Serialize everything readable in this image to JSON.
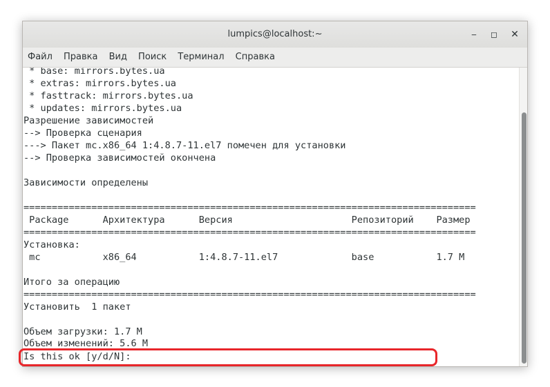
{
  "window": {
    "title": "lumpics@localhost:~",
    "controls": {
      "minimize": "‒",
      "maximize": "◻",
      "close": "✕"
    }
  },
  "menu": [
    "Файл",
    "Правка",
    "Вид",
    "Поиск",
    "Терминал",
    "Справка"
  ],
  "terminal_lines": [
    " * base: mirrors.bytes.ua",
    " * extras: mirrors.bytes.ua",
    " * fasttrack: mirrors.bytes.ua",
    " * updates: mirrors.bytes.ua",
    "Разрешение зависимостей",
    "--> Проверка сценария",
    "---> Пакет mc.x86_64 1:4.8.7-11.el7 помечен для установки",
    "--> Проверка зависимостей окончена",
    "",
    "Зависимости определены",
    "",
    "================================================================================",
    " Package      Архитектура      Версия                     Репозиторий    Размер",
    "================================================================================",
    "Установка:",
    " mc           x86_64           1:4.8.7-11.el7             base           1.7 M",
    "",
    "Итого за операцию",
    "================================================================================",
    "Установить  1 пакет",
    "",
    "Объем загрузки: 1.7 M",
    "Объем изменений: 5.6 M",
    "Is this ok [y/d/N]: "
  ],
  "colors": {
    "text": "#2e3436",
    "highlight_border": "#e8262a",
    "terminal_bg": "#ffffff"
  }
}
